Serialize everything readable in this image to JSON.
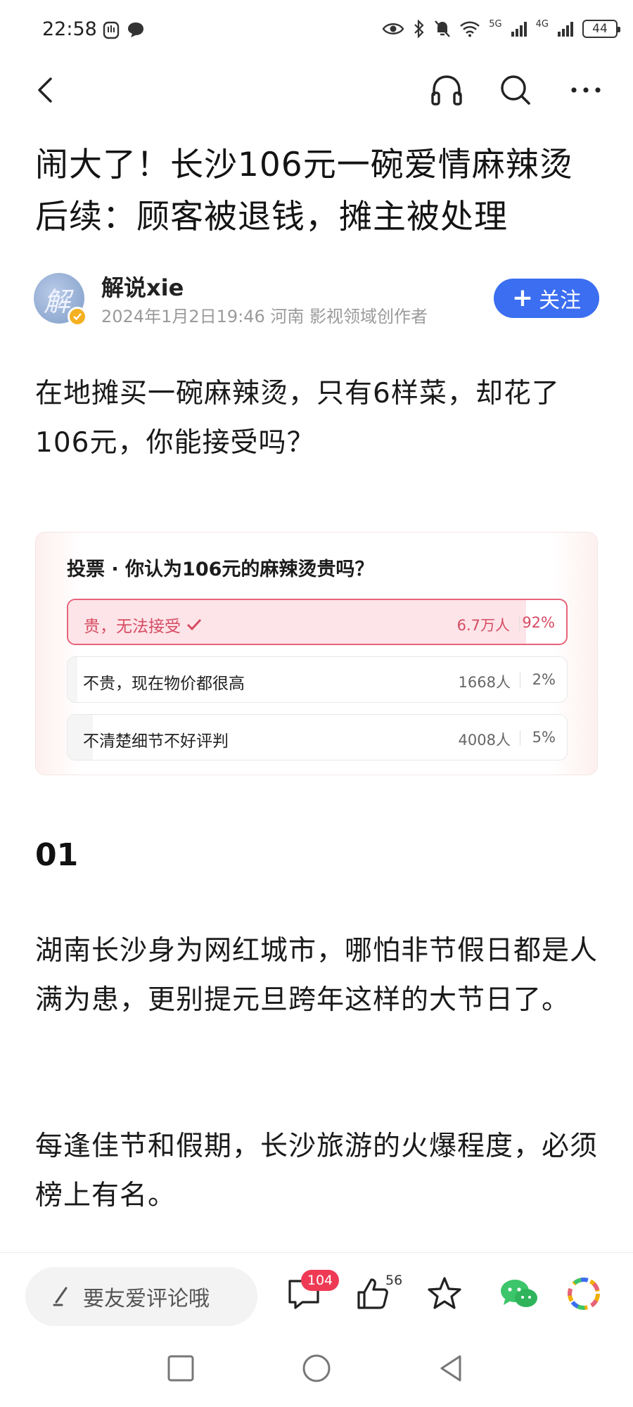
{
  "status_bar": {
    "time": "22:58",
    "network_1": "5G",
    "network_2": "4G",
    "battery": "44"
  },
  "article": {
    "title": "闹大了！长沙106元一碗爱情麻辣烫后续：顾客被退钱，摊主被处理",
    "author_name": "解说xie",
    "author_meta": "2024年1月2日19:46 河南 影视领域创作者",
    "avatar_char": "解",
    "follow_label": "关注",
    "intro": "在地摊买一碗麻辣烫，只有6样菜，却花了106元，你能接受吗？",
    "section_heading": "01",
    "para_1": "湖南长沙身为网红城市，哪怕非节假日都是人满为患，更别提元旦跨年这样的大节日了。",
    "para_2": "每逢佳节和假期，长沙旅游的火爆程度，必须榜上有名。"
  },
  "poll": {
    "question": "投票 · 你认为106元的麻辣烫贵吗？",
    "options": [
      {
        "label": "贵，无法接受",
        "count": "6.7万人",
        "percent": "92%",
        "fraction": 0.92,
        "selected": true
      },
      {
        "label": "不贵，现在物价都很高",
        "count": "1668人",
        "percent": "2%",
        "fraction": 0.02,
        "selected": false
      },
      {
        "label": "不清楚细节不好评判",
        "count": "4008人",
        "percent": "5%",
        "fraction": 0.05,
        "selected": false
      }
    ]
  },
  "toolbar": {
    "comment_placeholder": "要友爱评论哦",
    "comment_count": "104",
    "like_count": "56"
  },
  "colors": {
    "accent_blue": "#3b6ef0",
    "poll_selected": "#e7637a",
    "badge_red": "#ee3a55"
  },
  "icons": [
    "back-icon",
    "headphones-icon",
    "search-icon",
    "more-icon",
    "pen-icon",
    "comment-icon",
    "like-icon",
    "star-icon",
    "wechat-icon",
    "moments-icon",
    "home-square-icon",
    "home-circle-icon",
    "back-triangle-icon"
  ]
}
